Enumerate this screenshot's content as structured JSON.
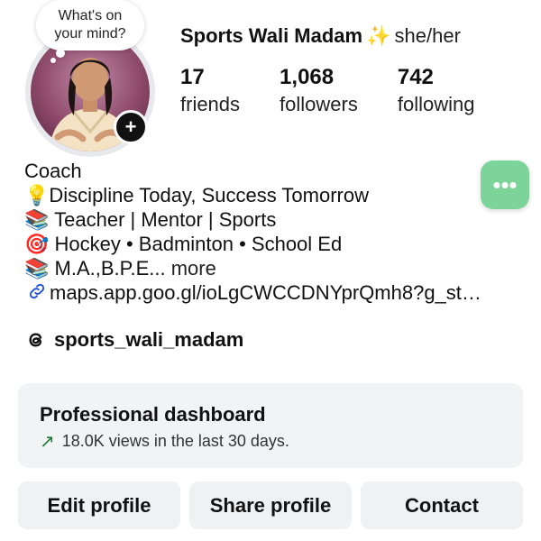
{
  "note": {
    "line1": "What's on",
    "line2": "your mind?"
  },
  "profile": {
    "name": "Sports Wali Madam",
    "sparkle": "✨",
    "pronouns": "she/her",
    "add_badge": "+"
  },
  "stats": [
    {
      "count": "17",
      "label": "friends"
    },
    {
      "count": "1,068",
      "label": "followers"
    },
    {
      "count": "742",
      "label": "following"
    }
  ],
  "bio": {
    "category": "Coach",
    "lines": [
      {
        "emoji": "💡",
        "text": "Discipline Today, Success Tomorrow"
      },
      {
        "emoji": "📚",
        "text": " Teacher | Mentor | Sports"
      },
      {
        "emoji": "🎯",
        "text": " Hockey • Badminton • School Ed"
      },
      {
        "emoji": "📚",
        "text": " M.A.,B.P.E... ",
        "more": "more"
      }
    ],
    "link": "maps.app.goo.gl/ioLgCWCCDNYprQmh8?g_st…"
  },
  "threads": {
    "handle": "sports_wali_madam"
  },
  "dashboard": {
    "title": "Professional dashboard",
    "arrow": "↗",
    "subtitle": "18.0K views in the last 30 days."
  },
  "actions": {
    "edit": "Edit profile",
    "share": "Share profile",
    "contact": "Contact"
  },
  "float_button": "•••",
  "colors": {
    "float_button": "#7dd49a",
    "dashboard_bg": "#f2f3f5",
    "button_bg": "#f0f1f3",
    "trend_green": "#1a7f37",
    "link_blue": "#1d4ed8"
  }
}
